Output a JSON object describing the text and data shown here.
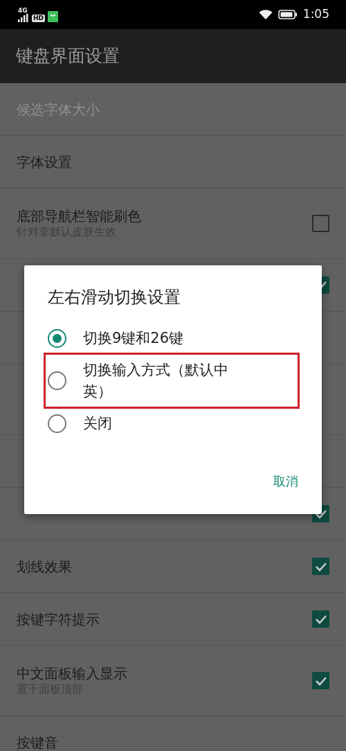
{
  "status_bar": {
    "network": "4G",
    "hd": "HD",
    "time": "1:05"
  },
  "app_bar": {
    "title": "键盘界面设置"
  },
  "settings": [
    {
      "title": "候选字体大小",
      "disabled": true
    },
    {
      "title": "字体设置",
      "disabled": false
    },
    {
      "title": "底部导航栏智能刷色",
      "subtitle": "针对非默认皮肤生效",
      "disabled": false,
      "checked": false
    },
    {
      "checked": true
    },
    {
      "tall": false
    },
    {
      "tall": true
    },
    {
      "tall": false
    },
    {
      "checked": true
    },
    {
      "title": "划线效果",
      "disabled": false,
      "checked": true
    },
    {
      "title": "按键字符提示",
      "disabled": false,
      "checked": true
    },
    {
      "title": "中文面板输入显示",
      "subtitle": "置于面板顶部",
      "disabled": false,
      "checked": true
    },
    {
      "title": "按键音",
      "disabled": false
    }
  ],
  "dialog": {
    "title": "左右滑动切换设置",
    "options": [
      {
        "label": "切换9键和26键",
        "selected": true,
        "highlighted": false
      },
      {
        "label": "切换输入方式（默认中英）",
        "selected": false,
        "highlighted": true
      },
      {
        "label": "关闭",
        "selected": false,
        "highlighted": false
      }
    ],
    "cancel": "取消"
  }
}
